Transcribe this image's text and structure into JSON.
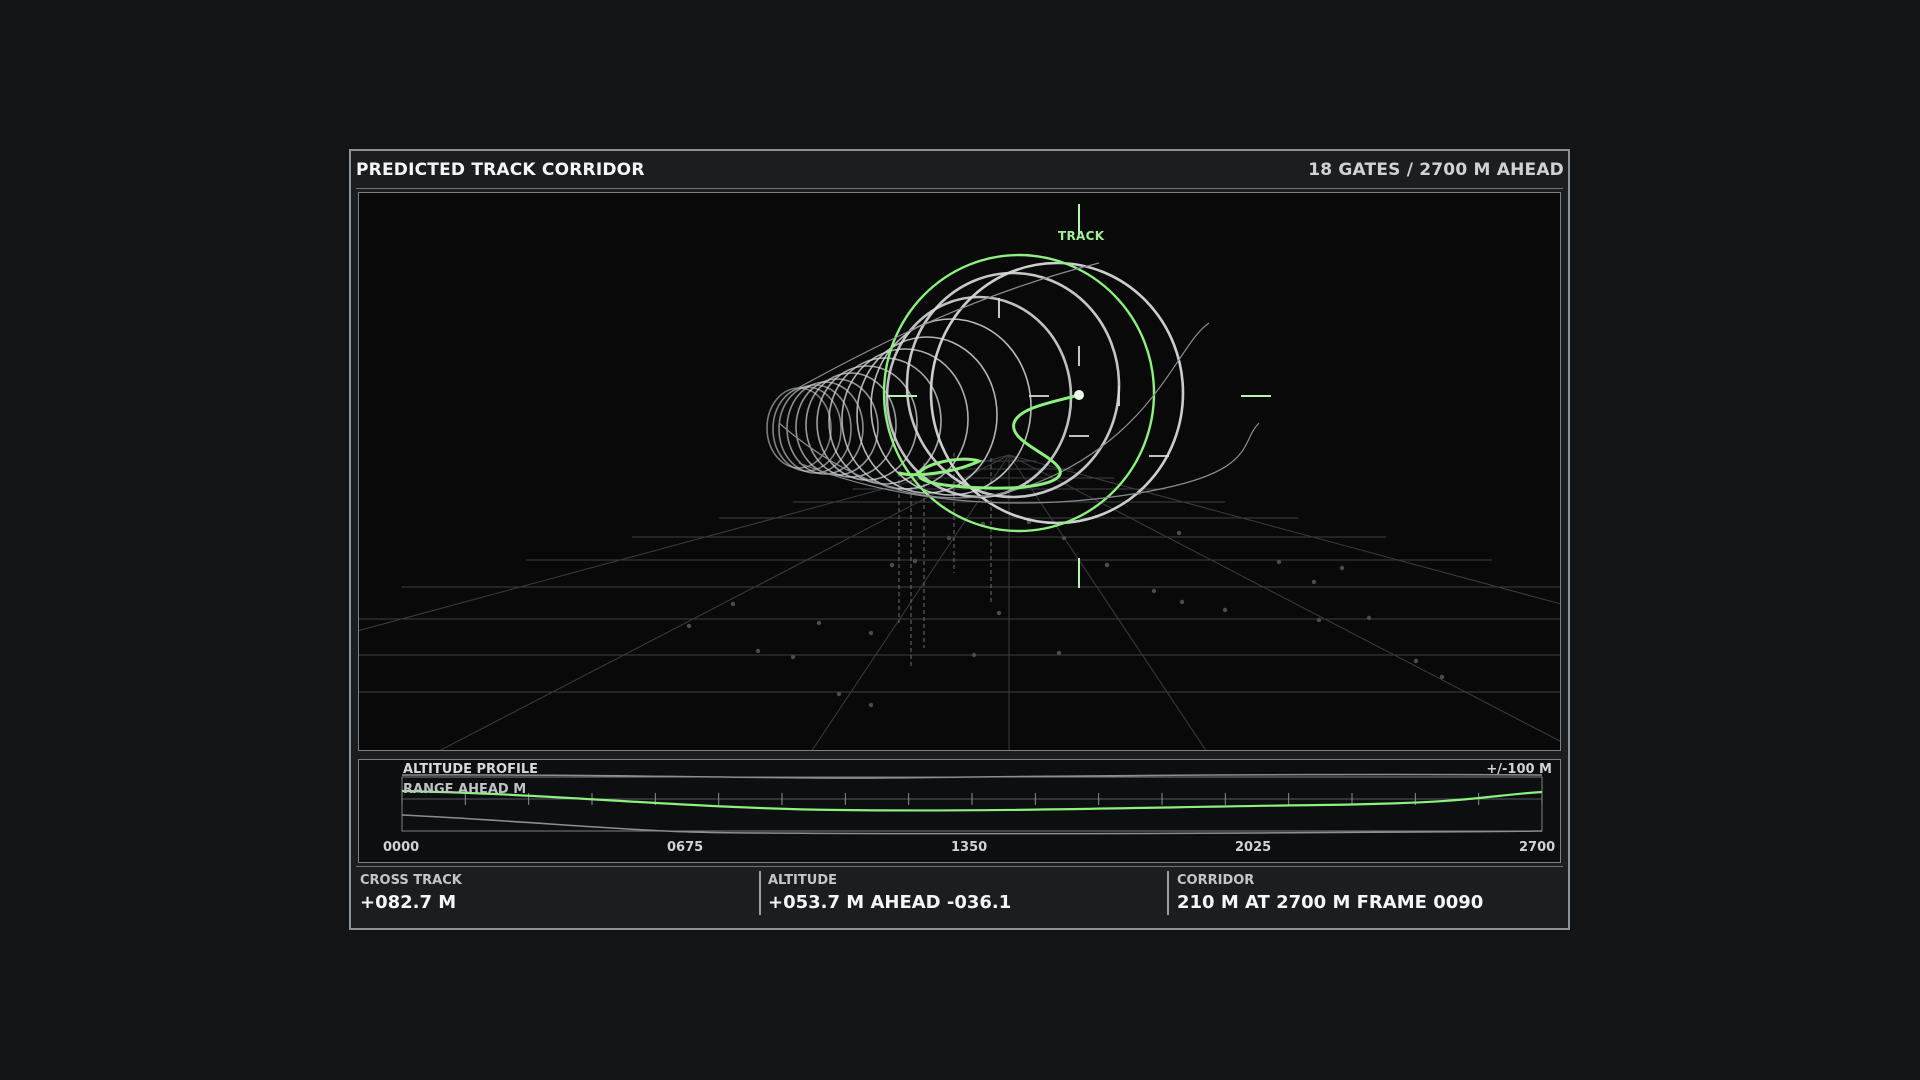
{
  "header": {
    "title": "PREDICTED TRACK CORRIDOR",
    "summary": "18 GATES / 2700 M AHEAD"
  },
  "viewport": {
    "track_label": "TRACK"
  },
  "profile": {
    "title": "ALTITUDE PROFILE",
    "axis_label": "RANGE AHEAD  M",
    "scale": "+/-100 M",
    "ticks": [
      "0000",
      "0675",
      "1350",
      "2025",
      "2700"
    ]
  },
  "stats": {
    "cross_track": {
      "label": "CROSS TRACK",
      "value": "+082.7 M"
    },
    "altitude": {
      "label": "ALTITUDE",
      "value": "+053.7 M  AHEAD -036.1"
    },
    "corridor": {
      "label": "CORRIDOR",
      "value": "210 M AT 2700 M  FRAME 0090"
    }
  },
  "colors": {
    "accent_green": "#8df07f",
    "gate_white": "#d8dadc",
    "background": "#121416"
  }
}
